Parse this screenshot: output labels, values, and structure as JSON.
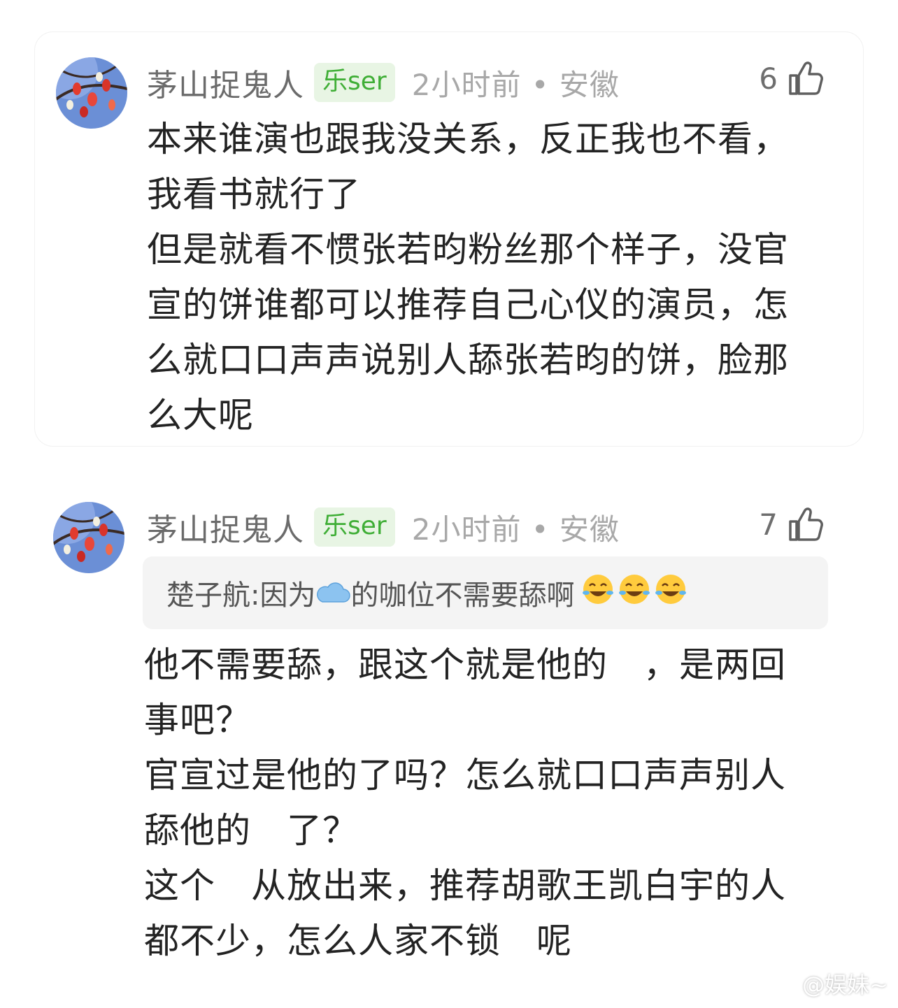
{
  "comments": [
    {
      "username": "茅山捉鬼人",
      "badge": "乐ser",
      "meta": "2小时前 • 安徽",
      "likes": "6",
      "text": "本来谁演也跟我没关系，反正我也不看，\n我看书就行了\n但是就看不惯张若昀粉丝那个样子，没官\n宣的饼谁都可以推荐自己心仪的演员，怎\n么就口口声声说别人舔张若昀的饼，脸那\n么大呢"
    },
    {
      "username": "茅山捉鬼人",
      "badge": "乐ser",
      "meta": "2小时前 • 安徽",
      "likes": "7",
      "quote": {
        "author": "楚子航: ",
        "before_emoji": "因为",
        "after_emoji": "的咖位不需要舔啊"
      },
      "text": "他不需要舔，跟这个就是他的　，是两回\n事吧？\n官宣过是他的了吗？怎么就口口声声别人\n舔他的　了？\n这个　从放出来，推荐胡歌王凯白宇的人\n都不少，怎么人家不锁　呢"
    }
  ],
  "watermark": "@娱妹~",
  "colors": {
    "badge_bg": "#e8f5e4",
    "badge_text": "#3fae36",
    "username": "#6b6b6b",
    "meta": "#a8a8a8"
  },
  "icons": [
    "thumbs-up-icon",
    "cloud-emoji-icon",
    "laughing-tears-emoji-icon",
    "weibo-logo-icon"
  ]
}
